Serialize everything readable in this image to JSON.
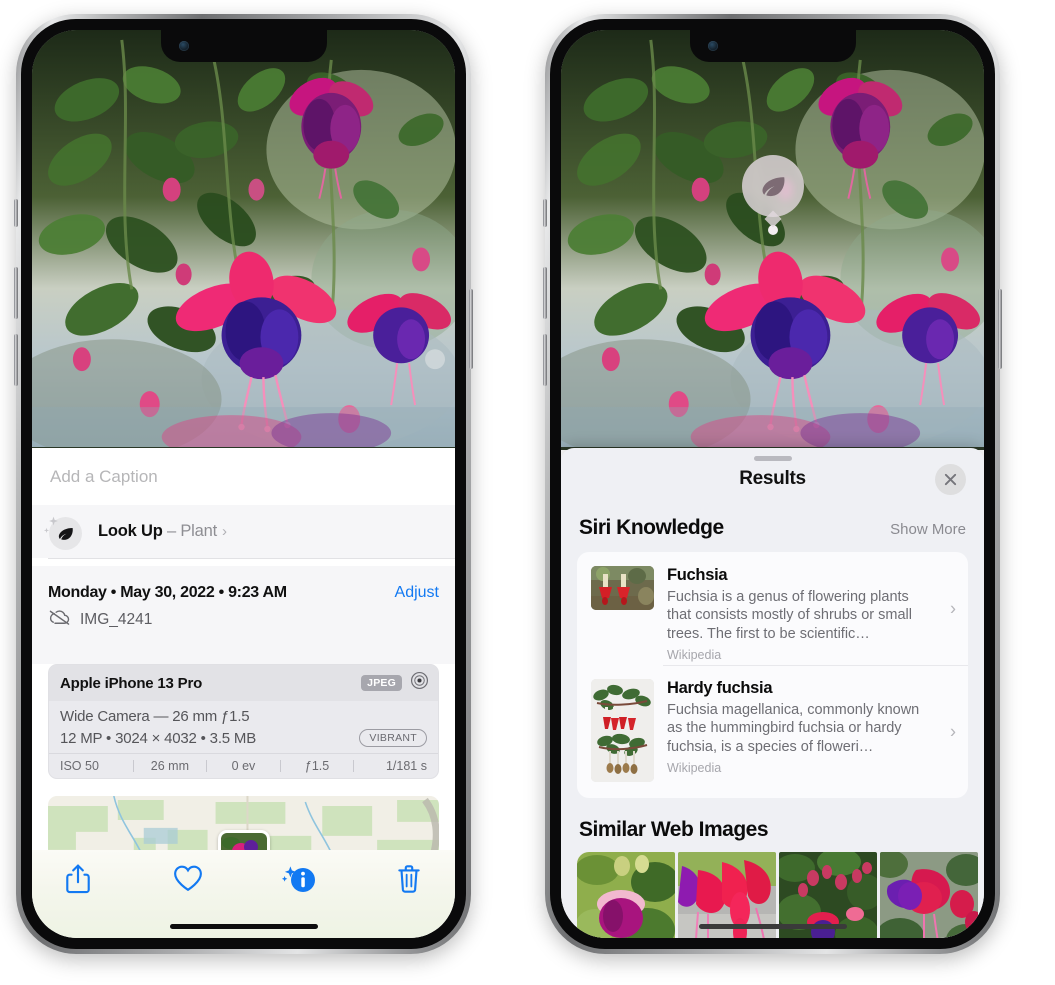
{
  "left_phone": {
    "name": "Photos app photo detail view",
    "caption": {
      "placeholder": "Add a Caption",
      "value": ""
    },
    "lookup": {
      "icon": "leaf-icon",
      "sparkle_icon": "sparkles-icon",
      "label": "Look Up",
      "dash": "–",
      "subject": "Plant",
      "chevron": "›"
    },
    "meta": {
      "date": "Monday • May 30, 2022 • 9:23 AM",
      "adjust_label": "Adjust",
      "cloud_icon": "cloud-slash-icon",
      "filename": "IMG_4241"
    },
    "camera_card": {
      "model": "Apple iPhone 13 Pro",
      "format_tag": "JPEG",
      "raw_icon": "aperture-icon",
      "lens_line": "Wide Camera — 26 mm ƒ1.5",
      "specs_line": "12 MP • 3024 × 4032 • 3.5 MB",
      "style_tag": "VIBRANT",
      "exif": [
        "ISO 50",
        "26 mm",
        "0 ev",
        "ƒ1.5",
        "1/181 s"
      ]
    },
    "map": {
      "name": "location-map",
      "pin": "photo-thumbnail-pin"
    },
    "toolbar": [
      {
        "name": "share-button",
        "icon": "share-icon"
      },
      {
        "name": "favorite-button",
        "icon": "heart-icon"
      },
      {
        "name": "info-button",
        "icon": "info-sparkle-icon",
        "active": true
      },
      {
        "name": "delete-button",
        "icon": "trash-icon"
      }
    ],
    "accent_color": "#1279f2"
  },
  "right_phone": {
    "name": "Visual Look Up results view",
    "badge": {
      "icon": "leaf-icon",
      "label": "visual-lookup-badge"
    },
    "sheet": {
      "title": "Results",
      "close_icon": "close-icon",
      "sections": [
        {
          "title": "Siri Knowledge",
          "action_label": "Show More",
          "items": [
            {
              "title": "Fuchsia",
              "description": "Fuchsia is a genus of flowering plants that consists mostly of shrubs or small trees. The first to be scientific…",
              "source": "Wikipedia",
              "chevron": "›"
            },
            {
              "title": "Hardy fuchsia",
              "description": "Fuchsia magellanica, commonly known as the hummingbird fuchsia or hardy fuchsia, is a species of floweri…",
              "source": "Wikipedia",
              "chevron": "›"
            }
          ]
        },
        {
          "title": "Similar Web Images",
          "items": [
            {
              "name": "similar-image-1"
            },
            {
              "name": "similar-image-2"
            },
            {
              "name": "similar-image-3"
            },
            {
              "name": "similar-image-4"
            }
          ]
        }
      ]
    }
  },
  "colors": {
    "accent_blue": "#1279f2",
    "sheet_bg": "#eff0f4",
    "card_bg": "#fbfbfd",
    "secondary_text": "#8e8e93"
  }
}
